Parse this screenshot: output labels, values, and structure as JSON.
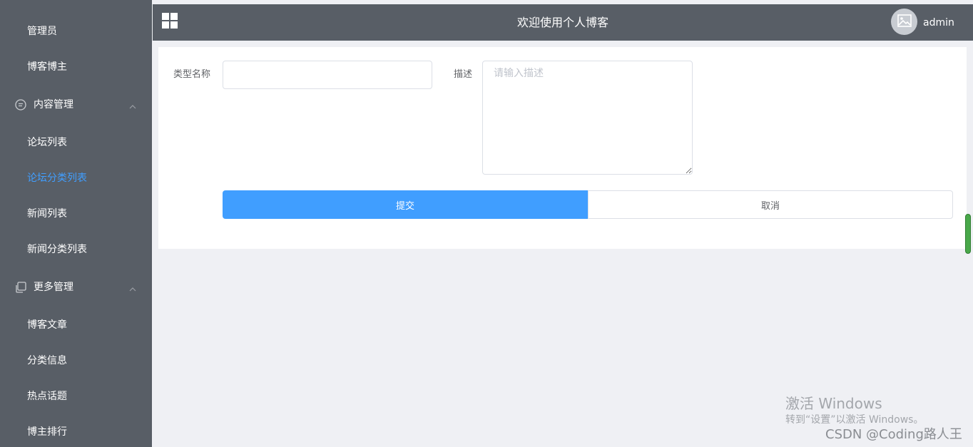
{
  "sidebar": {
    "items": [
      {
        "label": "管理员"
      },
      {
        "label": "博客博主"
      },
      {
        "label": "内容管理"
      },
      {
        "label": "论坛列表"
      },
      {
        "label": "论坛分类列表"
      },
      {
        "label": "新闻列表"
      },
      {
        "label": "新闻分类列表"
      },
      {
        "label": "更多管理"
      },
      {
        "label": "博客文章"
      },
      {
        "label": "分类信息"
      },
      {
        "label": "热点话题"
      },
      {
        "label": "博主排行"
      }
    ],
    "active_item": "论坛分类列表",
    "group_icons": [
      "chat-icon",
      "copy-icon"
    ]
  },
  "header": {
    "title": "欢迎使用个人博客",
    "username": "admin",
    "menu_icon": "grid-icon",
    "avatar_icon": "image-icon"
  },
  "form": {
    "name_label": "类型名称",
    "name_value": "",
    "desc_label": "描述",
    "desc_placeholder": "请输入描述",
    "submit_label": "提交",
    "cancel_label": "取消"
  },
  "watermark": {
    "line1": "激活 Windows",
    "line2": "转到“设置”以激活 Windows。",
    "credit": "CSDN @Coding路人王"
  },
  "colors": {
    "sidebar_bg": "#585e66",
    "accent": "#409eff",
    "page_bg": "#eff0f4"
  }
}
